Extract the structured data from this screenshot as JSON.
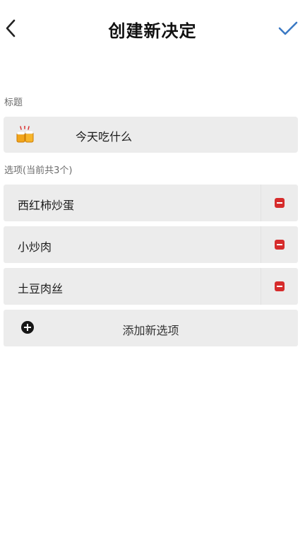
{
  "header": {
    "title": "创建新决定",
    "back_icon": "chevron-left-icon",
    "confirm_icon": "checkmark-icon",
    "confirm_color": "#3b79c4"
  },
  "title_section": {
    "label": "标题",
    "value": "今天吃什么",
    "emoji_icon": "cheers-emoji-icon"
  },
  "options_section": {
    "label": "选项(当前共3个)",
    "items": [
      {
        "label": "西红柿炒蛋"
      },
      {
        "label": "小炒肉"
      },
      {
        "label": "土豆肉丝"
      }
    ],
    "remove_icon": "minus-square-icon",
    "remove_color": "#d62c2c"
  },
  "add_option": {
    "label": "添加新选项",
    "icon": "plus-circle-icon"
  }
}
